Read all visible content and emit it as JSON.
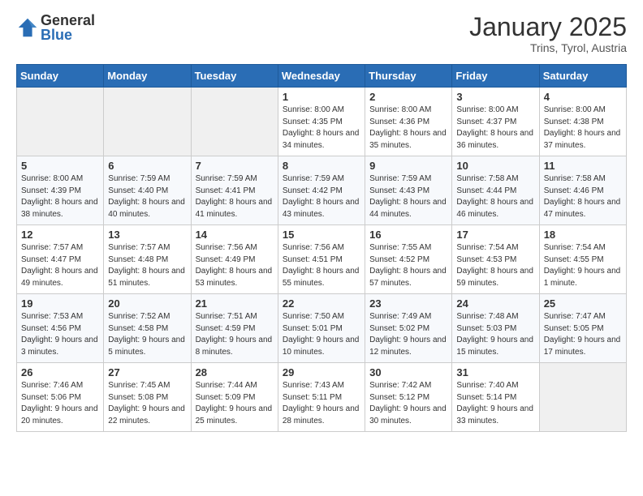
{
  "header": {
    "logo_general": "General",
    "logo_blue": "Blue",
    "month_title": "January 2025",
    "location": "Trins, Tyrol, Austria"
  },
  "weekdays": [
    "Sunday",
    "Monday",
    "Tuesday",
    "Wednesday",
    "Thursday",
    "Friday",
    "Saturday"
  ],
  "weeks": [
    [
      {
        "day": "",
        "info": ""
      },
      {
        "day": "",
        "info": ""
      },
      {
        "day": "",
        "info": ""
      },
      {
        "day": "1",
        "info": "Sunrise: 8:00 AM\nSunset: 4:35 PM\nDaylight: 8 hours\nand 34 minutes."
      },
      {
        "day": "2",
        "info": "Sunrise: 8:00 AM\nSunset: 4:36 PM\nDaylight: 8 hours\nand 35 minutes."
      },
      {
        "day": "3",
        "info": "Sunrise: 8:00 AM\nSunset: 4:37 PM\nDaylight: 8 hours\nand 36 minutes."
      },
      {
        "day": "4",
        "info": "Sunrise: 8:00 AM\nSunset: 4:38 PM\nDaylight: 8 hours\nand 37 minutes."
      }
    ],
    [
      {
        "day": "5",
        "info": "Sunrise: 8:00 AM\nSunset: 4:39 PM\nDaylight: 8 hours\nand 38 minutes."
      },
      {
        "day": "6",
        "info": "Sunrise: 7:59 AM\nSunset: 4:40 PM\nDaylight: 8 hours\nand 40 minutes."
      },
      {
        "day": "7",
        "info": "Sunrise: 7:59 AM\nSunset: 4:41 PM\nDaylight: 8 hours\nand 41 minutes."
      },
      {
        "day": "8",
        "info": "Sunrise: 7:59 AM\nSunset: 4:42 PM\nDaylight: 8 hours\nand 43 minutes."
      },
      {
        "day": "9",
        "info": "Sunrise: 7:59 AM\nSunset: 4:43 PM\nDaylight: 8 hours\nand 44 minutes."
      },
      {
        "day": "10",
        "info": "Sunrise: 7:58 AM\nSunset: 4:44 PM\nDaylight: 8 hours\nand 46 minutes."
      },
      {
        "day": "11",
        "info": "Sunrise: 7:58 AM\nSunset: 4:46 PM\nDaylight: 8 hours\nand 47 minutes."
      }
    ],
    [
      {
        "day": "12",
        "info": "Sunrise: 7:57 AM\nSunset: 4:47 PM\nDaylight: 8 hours\nand 49 minutes."
      },
      {
        "day": "13",
        "info": "Sunrise: 7:57 AM\nSunset: 4:48 PM\nDaylight: 8 hours\nand 51 minutes."
      },
      {
        "day": "14",
        "info": "Sunrise: 7:56 AM\nSunset: 4:49 PM\nDaylight: 8 hours\nand 53 minutes."
      },
      {
        "day": "15",
        "info": "Sunrise: 7:56 AM\nSunset: 4:51 PM\nDaylight: 8 hours\nand 55 minutes."
      },
      {
        "day": "16",
        "info": "Sunrise: 7:55 AM\nSunset: 4:52 PM\nDaylight: 8 hours\nand 57 minutes."
      },
      {
        "day": "17",
        "info": "Sunrise: 7:54 AM\nSunset: 4:53 PM\nDaylight: 8 hours\nand 59 minutes."
      },
      {
        "day": "18",
        "info": "Sunrise: 7:54 AM\nSunset: 4:55 PM\nDaylight: 9 hours\nand 1 minute."
      }
    ],
    [
      {
        "day": "19",
        "info": "Sunrise: 7:53 AM\nSunset: 4:56 PM\nDaylight: 9 hours\nand 3 minutes."
      },
      {
        "day": "20",
        "info": "Sunrise: 7:52 AM\nSunset: 4:58 PM\nDaylight: 9 hours\nand 5 minutes."
      },
      {
        "day": "21",
        "info": "Sunrise: 7:51 AM\nSunset: 4:59 PM\nDaylight: 9 hours\nand 8 minutes."
      },
      {
        "day": "22",
        "info": "Sunrise: 7:50 AM\nSunset: 5:01 PM\nDaylight: 9 hours\nand 10 minutes."
      },
      {
        "day": "23",
        "info": "Sunrise: 7:49 AM\nSunset: 5:02 PM\nDaylight: 9 hours\nand 12 minutes."
      },
      {
        "day": "24",
        "info": "Sunrise: 7:48 AM\nSunset: 5:03 PM\nDaylight: 9 hours\nand 15 minutes."
      },
      {
        "day": "25",
        "info": "Sunrise: 7:47 AM\nSunset: 5:05 PM\nDaylight: 9 hours\nand 17 minutes."
      }
    ],
    [
      {
        "day": "26",
        "info": "Sunrise: 7:46 AM\nSunset: 5:06 PM\nDaylight: 9 hours\nand 20 minutes."
      },
      {
        "day": "27",
        "info": "Sunrise: 7:45 AM\nSunset: 5:08 PM\nDaylight: 9 hours\nand 22 minutes."
      },
      {
        "day": "28",
        "info": "Sunrise: 7:44 AM\nSunset: 5:09 PM\nDaylight: 9 hours\nand 25 minutes."
      },
      {
        "day": "29",
        "info": "Sunrise: 7:43 AM\nSunset: 5:11 PM\nDaylight: 9 hours\nand 28 minutes."
      },
      {
        "day": "30",
        "info": "Sunrise: 7:42 AM\nSunset: 5:12 PM\nDaylight: 9 hours\nand 30 minutes."
      },
      {
        "day": "31",
        "info": "Sunrise: 7:40 AM\nSunset: 5:14 PM\nDaylight: 9 hours\nand 33 minutes."
      },
      {
        "day": "",
        "info": ""
      }
    ]
  ]
}
